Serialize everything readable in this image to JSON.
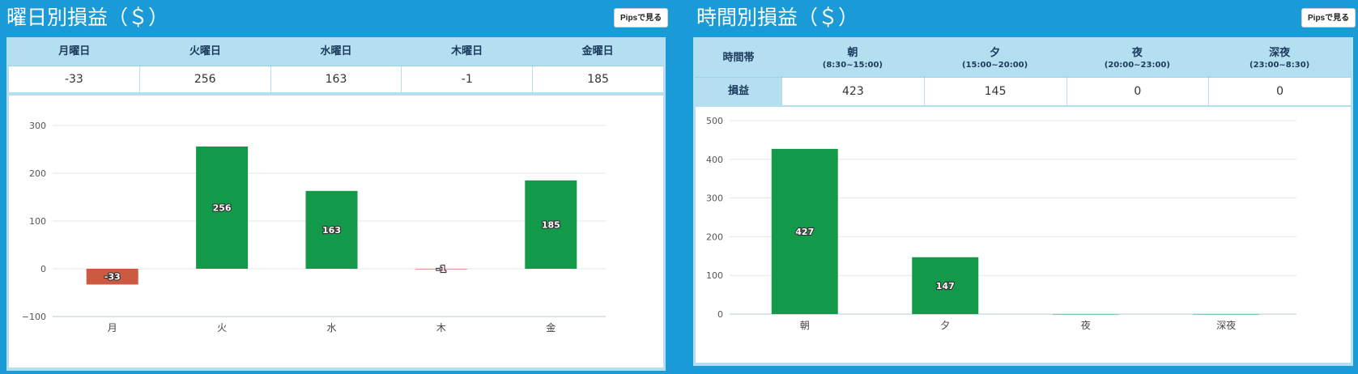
{
  "left_panel": {
    "title": "曜日別損益（＄）",
    "pips_button": "Pipsで見る",
    "headers": [
      "月曜日",
      "火曜日",
      "水曜日",
      "木曜日",
      "金曜日"
    ],
    "values": [
      "-33",
      "256",
      "163",
      "-1",
      "185"
    ]
  },
  "right_panel": {
    "title": "時間別損益（＄）",
    "pips_button": "Pipsで見る",
    "row_header": "時間帯",
    "row_label": "損益",
    "headers": [
      {
        "name": "朝",
        "range": "(8:30~15:00)"
      },
      {
        "name": "夕",
        "range": "(15:00~20:00)"
      },
      {
        "name": "夜",
        "range": "(20:00~23:00)"
      },
      {
        "name": "深夜",
        "range": "(23:00~8:30)"
      }
    ],
    "values": [
      "423",
      "145",
      "0",
      "0"
    ]
  },
  "colors": {
    "background": "#1a9ad6",
    "positive_bar": "#12994a",
    "negative_bar": "#cc5a40"
  },
  "chart_data": [
    {
      "type": "bar",
      "title": "",
      "categories": [
        "月",
        "火",
        "水",
        "木",
        "金"
      ],
      "values": [
        -33,
        256,
        163,
        -1,
        185
      ],
      "data_labels": [
        "-33",
        "256",
        "163",
        "-1",
        "185"
      ],
      "ylim": [
        -100,
        300
      ],
      "yticks": [
        -100,
        0,
        100,
        200,
        300
      ],
      "ytick_labels": [
        "−100",
        "0",
        "100",
        "200",
        "300"
      ],
      "grid": true,
      "xlabel": "",
      "ylabel": ""
    },
    {
      "type": "bar",
      "title": "",
      "categories": [
        "朝",
        "夕",
        "夜",
        "深夜"
      ],
      "values": [
        427,
        147,
        0,
        0
      ],
      "data_labels": [
        "427",
        "147",
        "",
        ""
      ],
      "ylim": [
        0,
        500
      ],
      "yticks": [
        0,
        100,
        200,
        300,
        400,
        500
      ],
      "ytick_labels": [
        "0",
        "100",
        "200",
        "300",
        "400",
        "500"
      ],
      "grid": true,
      "xlabel": "",
      "ylabel": ""
    }
  ]
}
